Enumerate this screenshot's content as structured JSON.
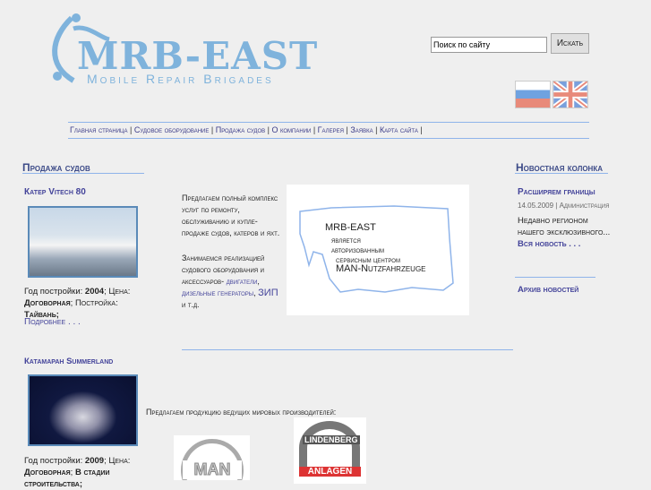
{
  "header": {
    "logo_title": "MRB-EAST",
    "logo_subtitle": "Mobile Repair Brigades",
    "search_placeholder": "Поиск по сайту",
    "search_button": "Искать",
    "flags": [
      "russian-flag",
      "english-flag"
    ]
  },
  "nav": [
    "Главная страница",
    "Судовое оборудование",
    "Продажа судов",
    "О компании",
    "Галерея",
    "Заявка",
    "Карта сайта"
  ],
  "left": {
    "title": "Продажа судов",
    "items": [
      {
        "name": "Катер Vitech 80",
        "year_label": "Год постройки:",
        "year": "2004",
        "price_label": "Цена:",
        "price": "Договорная",
        "extra_label": "Постройка:",
        "extra": "Тайвань;",
        "more": "Подробнее . . ."
      },
      {
        "name": "Катамаран Summerland",
        "year_label": "Год постройки:",
        "year": "2009",
        "price_label": "Цена:",
        "price": "Договорная",
        "extra": "В стадии строительства;"
      }
    ]
  },
  "center": {
    "p1": "Предлагаем полный комплекс услуг по ремонту, обслуживанию и купле-продаже судов, катеров и яхт.",
    "p2_text": "Занимаемся реализацией судового оборудования и аксессуаров-",
    "link_engines": "двигатели",
    "link_gens": "дизельные генераторы",
    "link_zip": "ЗИП",
    "p2_end": "и т.д.",
    "banner": {
      "l1": "MRB-EAST",
      "l2": "является",
      "l3": "авторизованным",
      "l4": "сервисным центром",
      "l5": "MAN-Nutzfahrzeuge"
    },
    "producers": "Предлагаем продукцию ведущих мировых производителей:",
    "logo_man": "MAN",
    "logo_lind": "LINDENBERG",
    "logo_lind2": "ANLAGEN"
  },
  "right": {
    "title": "Новостная колонка",
    "news_title": "Расширяем границы",
    "date": "14.05.2009",
    "author": "Администрация",
    "excerpt": "Недавно регионом нашего эксклюзивного...",
    "more": "Вся новость . . .",
    "archive": "Архив новостей"
  }
}
